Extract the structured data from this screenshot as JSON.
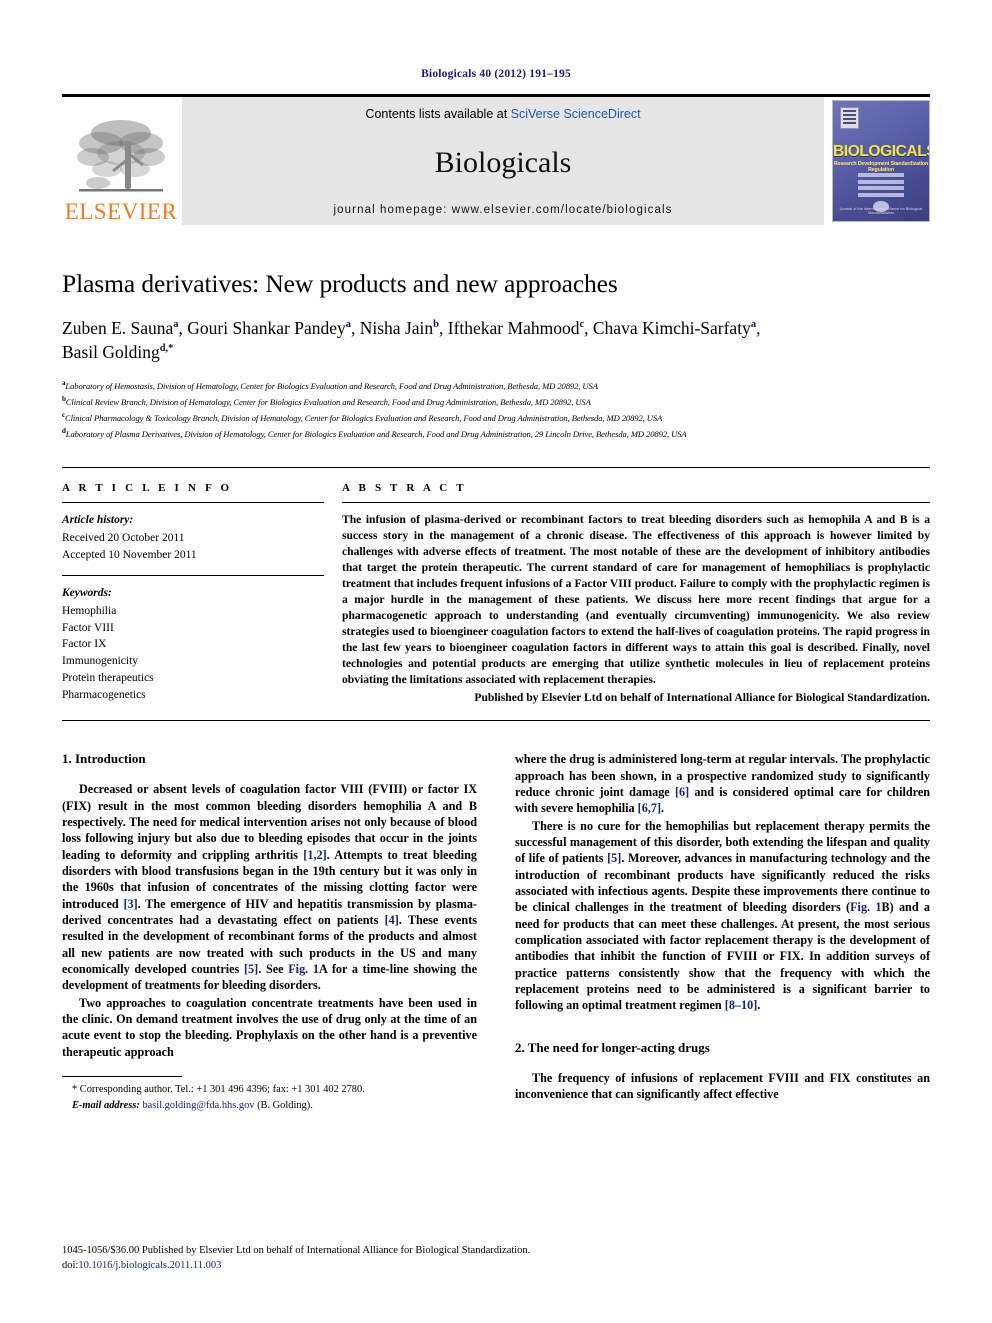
{
  "running_head": "Biologicals 40 (2012) 191–195",
  "masthead": {
    "publisher_logo_text": "ELSEVIER",
    "contents_prefix": "Contents lists available at ",
    "contents_link": "SciVerse ScienceDirect",
    "journal_name": "Biologicals",
    "homepage_line": "journal homepage: www.elsevier.com/locate/biologicals",
    "cover": {
      "title": "BIOLOGICALS",
      "subtitle": "Research  Development  Standardization  Regulation",
      "footer": "Journal of the International Alliance for Biological Standardization"
    }
  },
  "article": {
    "title": "Plasma derivatives: New products and new approaches",
    "authors": [
      {
        "name": "Zuben E. Sauna",
        "sup": "a",
        "sep": ", "
      },
      {
        "name": "Gouri Shankar Pandey",
        "sup": "a",
        "sep": ", "
      },
      {
        "name": "Nisha Jain",
        "sup": "b",
        "sep": ", "
      },
      {
        "name": "Ifthekar Mahmood",
        "sup": "c",
        "sep": ", "
      },
      {
        "name": "Chava Kimchi-Sarfaty",
        "sup": "a",
        "sep": ","
      },
      {
        "name": "Basil Golding",
        "sup": "d,*",
        "sep": ""
      }
    ],
    "affiliations": [
      {
        "mark": "a",
        "text": "Laboratory of Hemostasis, Division of Hematology, Center for Biologics Evaluation and Research, Food and Drug Administration, Bethesda, MD 20892, USA"
      },
      {
        "mark": "b",
        "text": "Clinical Review Branch, Division of Hematology, Center for Biologics Evaluation and Research, Food and Drug Administration, Bethesda, MD 20892, USA"
      },
      {
        "mark": "c",
        "text": "Clinical Pharmacology & Toxicology Branch, Division of Hematology, Center for Biologics Evaluation and Research, Food and Drug Administration, Bethesda, MD 20892, USA"
      },
      {
        "mark": "d",
        "text": "Laboratory of Plasma Derivatives, Division of Hematology, Center for Biologics Evaluation and Research, Food and Drug Administration, 29 Lincoln Drive, Bethesda, MD 20892, USA"
      }
    ]
  },
  "article_info": {
    "heading": "A R T I C L E   I N F O",
    "history_label": "Article history:",
    "received": "Received 20 October 2011",
    "accepted": "Accepted 10 November 2011",
    "keywords_label": "Keywords:",
    "keywords": [
      "Hemophilia",
      "Factor VIII",
      "Factor IX",
      "Immunogenicity",
      "Protein therapeutics",
      "Pharmacogenetics"
    ]
  },
  "abstract": {
    "heading": "A B S T R A C T",
    "text": "The infusion of plasma-derived or recombinant factors to treat bleeding disorders such as hemophila A and B is a success story in the management of a chronic disease. The effectiveness of this approach is however limited by challenges with adverse effects of treatment. The most notable of these are the development of inhibitory antibodies that target the protein therapeutic. The current standard of care for management of hemophiliacs is prophylactic treatment that includes frequent infusions of a Factor VIII product. Failure to comply with the prophylactic regimen is a major hurdle in the management of these patients. We discuss here more recent findings that argue for a pharmacogenetic approach to understanding (and eventually circumventing) immunogenicity. We also review strategies used to bioengineer coagulation factors to extend the half-lives of coagulation proteins. The rapid progress in the last few years to bioengineer coagulation factors in different ways to attain this goal is described. Finally, novel technologies and potential products are emerging that utilize synthetic molecules in lieu of replacement proteins obviating the limitations associated with replacement therapies.",
    "published_by": "Published by Elsevier Ltd on behalf of International Alliance for Biological Standardization."
  },
  "body": {
    "section1_heading": "1.  Introduction",
    "p1_a": "Decreased or absent levels of coagulation factor VIII (FVIII) or factor IX (FIX) result in the most common bleeding disorders hemophilia A and B respectively. The need for medical intervention arises not only because of blood loss following injury but also due to bleeding episodes that occur in the joints leading to deformity and crippling arthritis ",
    "p1_ref1": "[1,2]",
    "p1_b": ". Attempts to treat bleeding disorders with blood transfusions began in the 19th century but it was only in the 1960s that infusion of concentrates of the missing clotting factor were introduced ",
    "p1_ref2": "[3]",
    "p1_c": ". The emergence of HIV and hepatitis transmission by plasma-derived concentrates had a devastating effect on patients ",
    "p1_ref3": "[4]",
    "p1_d": ". These events resulted in the development of recombinant forms of the products and almost all new patients are now treated with such products in the US and many economically developed countries ",
    "p1_ref4": "[5]",
    "p1_e": ". See ",
    "p1_figref": "Fig. 1",
    "p1_f": "A for a time-line showing the development of treatments for bleeding disorders.",
    "p2": "Two approaches to coagulation concentrate treatments have been used in the clinic. On demand treatment involves the use of drug only at the time of an acute event to stop the bleeding. Prophylaxis on the other hand is a preventive therapeutic approach",
    "p3_a": "where the drug is administered long-term at regular intervals. The prophylactic approach has been shown, in a prospective randomized study to significantly reduce chronic joint damage ",
    "p3_ref1": "[6]",
    "p3_b": " and is considered optimal care for children with severe hemophilia ",
    "p3_ref2": "[6,7]",
    "p3_c": ".",
    "p4_a": "There is no cure for the hemophilias but replacement therapy permits the successful management of this disorder, both extending the lifespan and quality of life of patients ",
    "p4_ref1": "[5]",
    "p4_b": ". Moreover, advances in manufacturing technology and the introduction of recombinant products have significantly reduced the risks associated with infectious agents. Despite these improvements there continue to be clinical challenges in the treatment of bleeding disorders (",
    "p4_figref": "Fig. 1",
    "p4_c": "B) and a need for products that can meet these challenges. At present, the most serious complication associated with factor replacement therapy is the development of antibodies that inhibit the function of FVIII or FIX. In addition surveys of practice patterns consistently show that the frequency with which the replacement proteins need to be administered is a significant barrier to following an optimal treatment regimen ",
    "p4_ref2": "[8–10]",
    "p4_d": ".",
    "section2_heading": "2.  The need for longer-acting drugs",
    "p5": "The frequency of infusions of replacement FVIII and FIX constitutes an inconvenience that can significantly affect effective"
  },
  "footnote": {
    "corresponding": "* Corresponding author. Tel.: +1 301 496 4396; fax: +1 301 402 2780.",
    "email_label": "E-mail address:",
    "email": "basil.golding@fda.hhs.gov",
    "email_suffix": "(B. Golding)."
  },
  "page_footer": {
    "copyright": "1045-1056/$36.00 Published by Elsevier Ltd on behalf of International Alliance for Biological Standardization.",
    "doi_label": "doi:",
    "doi_value": "10.1016/j.biologicals.2011.11.003"
  }
}
